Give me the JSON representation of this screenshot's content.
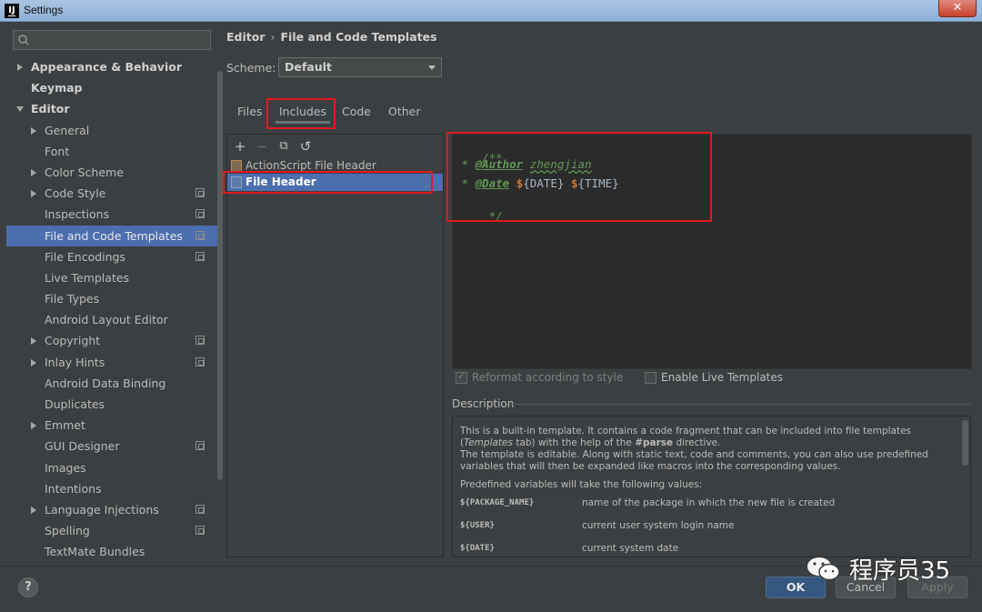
{
  "window": {
    "title": "Settings",
    "close_glyph": "✕"
  },
  "sidebar": {
    "search_placeholder": "",
    "items": [
      {
        "label": "Appearance & Behavior",
        "level": 0,
        "arrow": "right",
        "bold": true
      },
      {
        "label": "Keymap",
        "level": 0,
        "arrow": "none",
        "bold": true
      },
      {
        "label": "Editor",
        "level": 0,
        "arrow": "down",
        "bold": true
      },
      {
        "label": "General",
        "level": 1,
        "arrow": "right"
      },
      {
        "label": "Font",
        "level": 1,
        "arrow": "none"
      },
      {
        "label": "Color Scheme",
        "level": 1,
        "arrow": "right"
      },
      {
        "label": "Code Style",
        "level": 1,
        "arrow": "right",
        "project": true
      },
      {
        "label": "Inspections",
        "level": 1,
        "arrow": "none",
        "project": true
      },
      {
        "label": "File and Code Templates",
        "level": 1,
        "arrow": "none",
        "project": true,
        "selected": true
      },
      {
        "label": "File Encodings",
        "level": 1,
        "arrow": "none",
        "project": true
      },
      {
        "label": "Live Templates",
        "level": 1,
        "arrow": "none"
      },
      {
        "label": "File Types",
        "level": 1,
        "arrow": "none"
      },
      {
        "label": "Android Layout Editor",
        "level": 1,
        "arrow": "none"
      },
      {
        "label": "Copyright",
        "level": 1,
        "arrow": "right",
        "project": true
      },
      {
        "label": "Inlay Hints",
        "level": 1,
        "arrow": "right",
        "project": true
      },
      {
        "label": "Android Data Binding",
        "level": 1,
        "arrow": "none"
      },
      {
        "label": "Duplicates",
        "level": 1,
        "arrow": "none"
      },
      {
        "label": "Emmet",
        "level": 1,
        "arrow": "right"
      },
      {
        "label": "GUI Designer",
        "level": 1,
        "arrow": "none",
        "project": true
      },
      {
        "label": "Images",
        "level": 1,
        "arrow": "none"
      },
      {
        "label": "Intentions",
        "level": 1,
        "arrow": "none"
      },
      {
        "label": "Language Injections",
        "level": 1,
        "arrow": "right",
        "project": true
      },
      {
        "label": "Spelling",
        "level": 1,
        "arrow": "none",
        "project": true
      },
      {
        "label": "TextMate Bundles",
        "level": 1,
        "arrow": "none"
      }
    ]
  },
  "breadcrumb": {
    "parent": "Editor",
    "separator": "›",
    "current": "File and Code Templates"
  },
  "scheme": {
    "label": "Scheme:",
    "value": "Default"
  },
  "tabs": [
    {
      "label": "Files"
    },
    {
      "label": "Includes",
      "active": true
    },
    {
      "label": "Code"
    },
    {
      "label": "Other"
    }
  ],
  "toolbar": {
    "add": "+",
    "remove": "−",
    "copy": "⧉",
    "reset": "↺"
  },
  "templates": [
    {
      "label": "ActionScript File Header",
      "icon": "actionscript-file-icon"
    },
    {
      "label": "File Header",
      "icon": "java-file-icon",
      "selected": true
    }
  ],
  "editor": {
    "line1": "/**",
    "line2_prefix": " * ",
    "author_tag": "@Author",
    "author_value": "zhengjian",
    "line3_prefix": " * ",
    "date_tag": "@Date",
    "dollar": "$",
    "date_var": "{DATE}",
    "time_var": "{TIME}",
    "line4": " */"
  },
  "options": {
    "reformat": "Reformat according to style",
    "live_templates": "Enable Live Templates"
  },
  "description": {
    "title": "Description",
    "p1_a": "This is a built-in template. It contains a code fragment that can be included into file templates (",
    "p1_em": "Templates",
    "p1_b": " tab) with the help of the ",
    "p1_parse": "#parse",
    "p1_c": " directive.",
    "p1_d": "The template is editable. Along with static text, code and comments, you can also use predefined variables that will then be expanded like macros into the corresponding values.",
    "p2": "Predefined variables will take the following values:",
    "vars": [
      {
        "name": "${PACKAGE_NAME}",
        "desc": "name of the package in which the new file is created"
      },
      {
        "name": "${USER}",
        "desc": "current user system login name"
      },
      {
        "name": "${DATE}",
        "desc": "current system date"
      }
    ]
  },
  "footer": {
    "help": "?",
    "ok": "OK",
    "cancel": "Cancel",
    "apply": "Apply"
  },
  "watermark": {
    "text": "程序员35"
  },
  "colors": {
    "selection": "#4b6eaf",
    "highlight": "#e0191f",
    "ok_button": "#365880"
  }
}
